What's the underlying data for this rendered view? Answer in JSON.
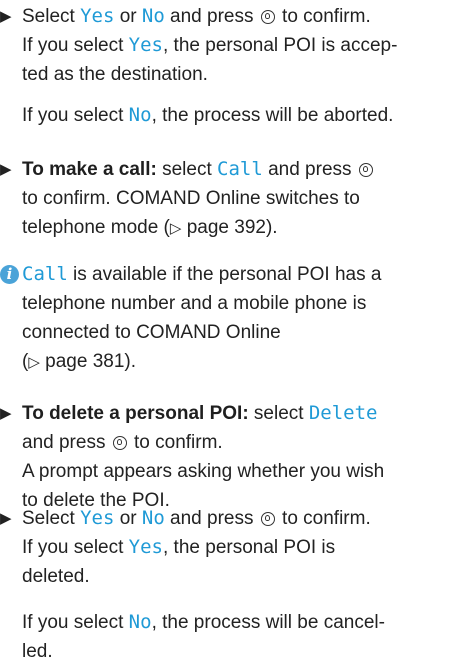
{
  "knob_icon": "controller-press-icon",
  "blocks": [
    {
      "kind": "step",
      "lines": [
        [
          [
            "t",
            "Select "
          ],
          [
            "k",
            "Yes"
          ],
          [
            "t",
            " or "
          ],
          [
            "k",
            "No"
          ],
          [
            "t",
            " and press "
          ],
          [
            "i",
            ""
          ],
          [
            "t",
            " to confirm."
          ]
        ],
        [
          [
            "t",
            "If you select "
          ],
          [
            "k",
            "Yes"
          ],
          [
            "t",
            ", the personal POI is accep-"
          ]
        ],
        [
          [
            "t",
            "ted as the destination."
          ]
        ]
      ]
    },
    {
      "kind": "text",
      "lines": [
        [
          [
            "t",
            "If you select "
          ],
          [
            "k",
            "No"
          ],
          [
            "t",
            ", the process will be aborted."
          ]
        ]
      ]
    },
    {
      "kind": "step",
      "lines": [
        [
          [
            "b",
            "To make a call:"
          ],
          [
            "t",
            " select "
          ],
          [
            "k",
            "Call"
          ],
          [
            "t",
            " and press "
          ],
          [
            "i",
            ""
          ]
        ],
        [
          [
            "t",
            "to confirm. COMAND Online switches to"
          ]
        ],
        [
          [
            "t",
            "telephone mode ("
          ],
          [
            "r",
            "▷"
          ],
          [
            "t",
            " page 392)."
          ]
        ]
      ]
    },
    {
      "kind": "info",
      "lines": [
        [
          [
            "k",
            "Call"
          ],
          [
            "t",
            " is available if the personal POI has a"
          ]
        ],
        [
          [
            "t",
            "telephone number and a mobile phone is"
          ]
        ],
        [
          [
            "t",
            "connected to COMAND Online"
          ]
        ],
        [
          [
            "t",
            "("
          ],
          [
            "r",
            "▷"
          ],
          [
            "t",
            " page 381)."
          ]
        ]
      ]
    },
    {
      "kind": "step",
      "lines": [
        [
          [
            "b",
            "To delete a personal POI:"
          ],
          [
            "t",
            " select "
          ],
          [
            "k",
            "Delete"
          ]
        ],
        [
          [
            "t",
            "and press "
          ],
          [
            "i",
            ""
          ],
          [
            "t",
            " to confirm."
          ]
        ],
        [
          [
            "t",
            "A prompt appears asking whether you wish"
          ]
        ],
        [
          [
            "t",
            "to delete the POI."
          ]
        ]
      ]
    },
    {
      "kind": "step",
      "lines": [
        [
          [
            "t",
            "Select "
          ],
          [
            "k",
            "Yes"
          ],
          [
            "t",
            " or "
          ],
          [
            "k",
            "No"
          ],
          [
            "t",
            " and press "
          ],
          [
            "i",
            ""
          ],
          [
            "t",
            " to confirm."
          ]
        ],
        [
          [
            "t",
            "If you select "
          ],
          [
            "k",
            "Yes"
          ],
          [
            "t",
            ", the personal POI is"
          ]
        ],
        [
          [
            "t",
            "deleted."
          ]
        ]
      ]
    },
    {
      "kind": "text",
      "lines": [
        [
          [
            "t",
            "If you select "
          ],
          [
            "k",
            "No"
          ],
          [
            "t",
            ", the process will be cancel-"
          ]
        ],
        [
          [
            "t",
            "led."
          ]
        ]
      ]
    }
  ]
}
